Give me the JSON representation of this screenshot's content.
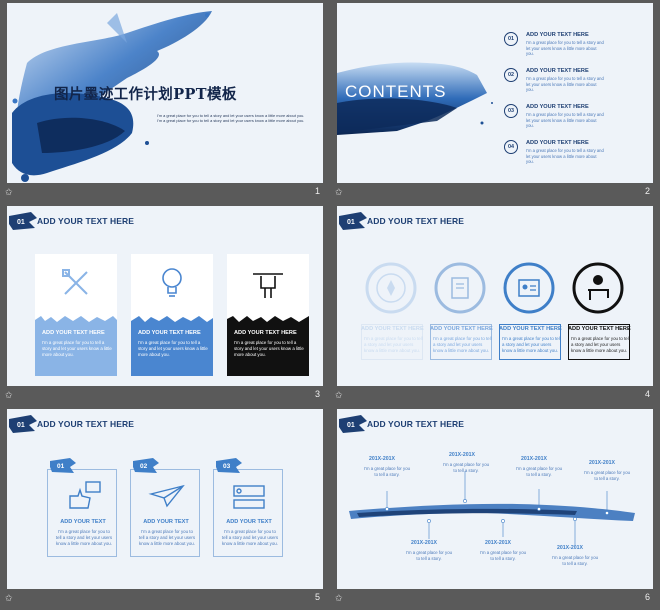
{
  "slides": [
    {
      "number": "1",
      "title": "图片墨迹工作计划PPT模板",
      "body": "I'm a great place for you to tell a story and let your users know a little more about you. I'm a great place for you to tell a story and let your users know a little more about you."
    },
    {
      "number": "2",
      "contents_label": "CONTENTS",
      "items": [
        {
          "index": "01",
          "heading": "ADD YOUR TEXT HERE",
          "body": "I'm a great place for you to tell a story and let your users know a little more about you."
        },
        {
          "index": "02",
          "heading": "ADD YOUR TEXT HERE",
          "body": "I'm a great place for you to tell a story and let your users know a little more about you."
        },
        {
          "index": "03",
          "heading": "ADD YOUR TEXT HERE",
          "body": "I'm a great place for you to tell a story and let your users know a little more about you."
        },
        {
          "index": "04",
          "heading": "ADD YOUR TEXT HERE",
          "body": "I'm a great place for you to tell a story and let your users know a little more about you."
        }
      ]
    },
    {
      "number": "3",
      "badge": "01",
      "header": "ADD YOUR TEXT HERE",
      "cards": [
        {
          "icon": "pencil-ruler-icon",
          "heading": "ADD YOUR TEXT HERE",
          "body": "I'm a great place for you to tell a story and let your users know a little more about you.",
          "color": "#8ab4e6"
        },
        {
          "icon": "lightbulb-icon",
          "heading": "ADD YOUR TEXT HERE",
          "body": "I'm a great place for you to tell a story and let your users know a little more about you.",
          "color": "#4a86d0"
        },
        {
          "icon": "hand-pen-icon",
          "heading": "ADD YOUR TEXT HERE",
          "body": "I'm a great place for you to tell a story and let your users know a little more about you.",
          "color": "#111111"
        }
      ]
    },
    {
      "number": "4",
      "badge": "01",
      "header": "ADD YOUR TEXT HERE",
      "items": [
        {
          "icon": "compass-icon",
          "heading": "ADD YOUR TEXT HERE",
          "body": "I'm a great place for you to tell a story and let your users know a little more about you."
        },
        {
          "icon": "book-icon",
          "heading": "ADD YOUR TEXT HERE",
          "body": "I'm a great place for you to tell a story and let your users know a little more about you."
        },
        {
          "icon": "id-card-icon",
          "heading": "ADD YOUR TEXT HERE",
          "body": "I'm a great place for you to tell a story and let your users know a little more about you."
        },
        {
          "icon": "desk-chair-icon",
          "heading": "ADD YOUR TEXT HERE",
          "body": "I'm a great place for you to tell a story and let your users know a little more about you."
        }
      ]
    },
    {
      "number": "5",
      "badge": "01",
      "header": "ADD YOUR TEXT HERE",
      "cards": [
        {
          "index": "01",
          "icon": "thumbs-up-chat-icon",
          "heading": "ADD YOUR TEXT",
          "body": "I'm a great place for you to tell a story and let your users know a little more about you."
        },
        {
          "index": "02",
          "icon": "paper-plane-icon",
          "heading": "ADD YOUR TEXT",
          "body": "I'm a great place for you to tell a story and let your users know a little more about you."
        },
        {
          "index": "03",
          "icon": "profile-card-icon",
          "heading": "ADD YOUR TEXT",
          "body": "I'm a great place for you to tell a story and let your users know a little more about you."
        }
      ]
    },
    {
      "number": "6",
      "badge": "01",
      "header": "ADD YOUR TEXT HERE",
      "events": [
        {
          "date": "201X-201X",
          "desc": "I'm a great place for you to tell a story."
        },
        {
          "date": "201X-201X",
          "desc": "I'm a great place for you to tell a story."
        },
        {
          "date": "201X-201X",
          "desc": "I'm a great place for you to tell a story."
        },
        {
          "date": "201X-201X",
          "desc": "I'm a great place for you to tell a story."
        },
        {
          "date": "201X-201X",
          "desc": "I'm a great place for you to tell a story."
        },
        {
          "date": "201X-201X",
          "desc": "I'm a great place for you to tell a story."
        },
        {
          "date": "201X-201X",
          "desc": "I'm a great place for you to tell a story."
        }
      ]
    }
  ],
  "colors": {
    "ink_dark": "#1e3f73",
    "ink_mid": "#3f7fc8",
    "ink_light": "#8ab4e6",
    "slide_bg": "#eef3f9",
    "app_bg": "#5a5a5a"
  }
}
